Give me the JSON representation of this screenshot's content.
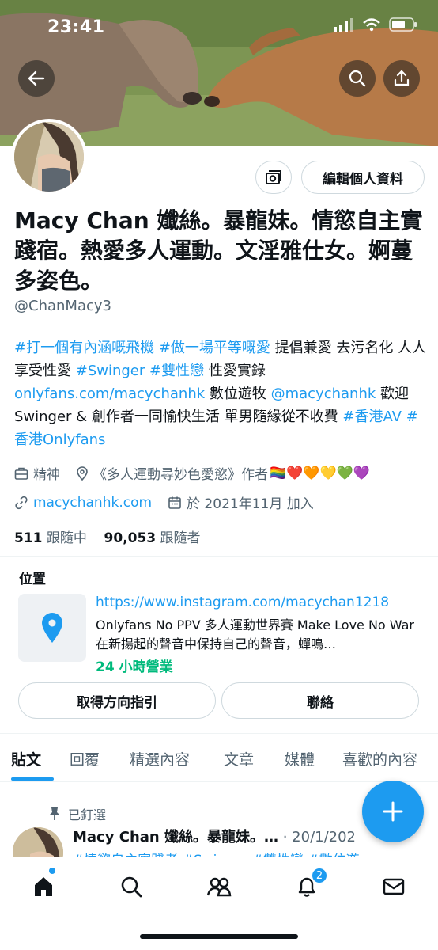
{
  "status": {
    "time": "23:41"
  },
  "profile": {
    "name": "Macy Chan 孅絲。暴龍妹。情慾自主實踐宿。熱愛多人運動。文淫雅仕女。婀蔓多姿色。",
    "handle": "@ChanMacy3",
    "edit_label": "編輯個人資料",
    "bio": {
      "tag1": "#打一個有內涵嘅飛機",
      "tag2": "#做一場平等嘅愛",
      "t1": " 提倡兼愛 去污名化 人人享受性愛 ",
      "tag3": "#Swinger",
      "tag4": "#雙性戀",
      "t2": " 性愛實錄 ",
      "link1": "onlyfans.com/macychanhk",
      "t3": " 數位遊牧 ",
      "mention": "@macychanhk",
      "t4": " 歡迎Swinger & 創作者一同愉快生活 單男隨緣從不收費 ",
      "tag5": "#香港AV",
      "tag6": "#香港Onlyfans"
    },
    "category": "精神",
    "location_text": "《多人運動尋妙色愛慾》作者",
    "hearts": "🏳️‍🌈❤️🧡💛💚💜",
    "website": "macychanhk.com",
    "joined": "於 2021年11月 加入",
    "following_count": "511",
    "following_label": "跟隨中",
    "followers_count": "90,053",
    "followers_label": "跟隨者"
  },
  "location_card": {
    "title": "位置",
    "url": "https://www.instagram.com/macychan1218",
    "description": "Onlyfans No PPV 多人運動世界賽 Make Love No War 在新揚起的聲音中保持自己的聲音，蟬鳴…",
    "hours": "24 小時營業",
    "directions_label": "取得方向指引",
    "contact_label": "聯絡"
  },
  "tabs": [
    "貼文",
    "回覆",
    "精選內容",
    "文章",
    "媒體",
    "喜歡的內容"
  ],
  "pinned_post": {
    "pinned_label": "已釘選",
    "author": "Macy Chan 孅絲。暴龍妹。…",
    "date": "· 20/1/202",
    "tags_preview": "#情慾自主實踐者 #Swinger #雙性戀 #數位遊"
  },
  "nav": {
    "notifications_badge": "2"
  },
  "colors": {
    "accent": "#1d9bf0",
    "green": "#00ba7c",
    "secondary_text": "#536471"
  }
}
